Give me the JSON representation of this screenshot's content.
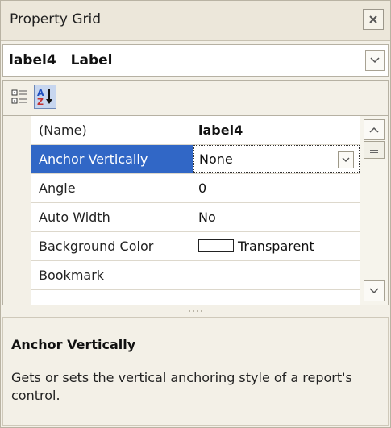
{
  "window": {
    "title": "Property Grid",
    "close_icon": "close-icon"
  },
  "selector": {
    "object_name": "label4",
    "object_type": "Label"
  },
  "toolbar": {
    "categorized_icon": "categorized-icon",
    "alphabetical_icon": "sort-alphabetical-icon",
    "alphabetical_active": true
  },
  "grid": {
    "rows": [
      {
        "name": "(Name)",
        "value": "label4"
      },
      {
        "name": "Anchor Vertically",
        "value": "None"
      },
      {
        "name": "Angle",
        "value": "0"
      },
      {
        "name": "Auto Width",
        "value": "No"
      },
      {
        "name": "Background Color",
        "value": "Transparent"
      },
      {
        "name": "Bookmark",
        "value": ""
      }
    ],
    "selected_row": "Anchor Vertically"
  },
  "description": {
    "title": "Anchor Vertically",
    "text": "Gets or sets the vertical anchoring style of a report's control."
  },
  "colors": {
    "selection": "#3167c6",
    "panel_bg": "#f3f0e7",
    "toolbar_active_bg": "#c7d6ef"
  }
}
